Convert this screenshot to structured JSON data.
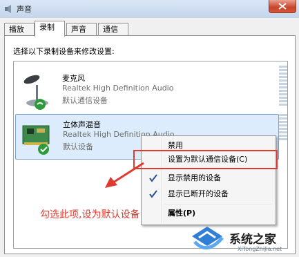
{
  "window": {
    "title": "声音"
  },
  "tabs": [
    {
      "label": "播放"
    },
    {
      "label": "录制",
      "selected": true
    },
    {
      "label": "声音"
    },
    {
      "label": "通信"
    }
  ],
  "instruction": "选择以下录制设备来修改设置:",
  "devices": [
    {
      "name": "麦克风",
      "driver": "Realtek High Definition Audio",
      "status": "默认通信设备",
      "icon": "microphone-icon",
      "badge": "phone-badge-icon"
    },
    {
      "name": "立体声混音",
      "driver": "Realtek High Definition Audio",
      "status": "默认设备",
      "icon": "sound-card-icon",
      "badge": "check-badge-icon",
      "selected": true
    }
  ],
  "context_menu": {
    "items": [
      {
        "label": "禁用"
      },
      {
        "label": "设置为默认通信设备(C)"
      },
      {
        "label": "显示禁用的设备",
        "checked": true
      },
      {
        "label": "显示已断开的设备",
        "checked": true
      },
      {
        "label": "属性(P)",
        "bold": true
      }
    ]
  },
  "annotation": "勾选此项,设为默认设备",
  "watermark": {
    "text": "系统之家",
    "url": "XiTongZhiJia.net"
  },
  "colors": {
    "annotation_red": "#e0392e",
    "selection_blue": "#dcecfc"
  }
}
